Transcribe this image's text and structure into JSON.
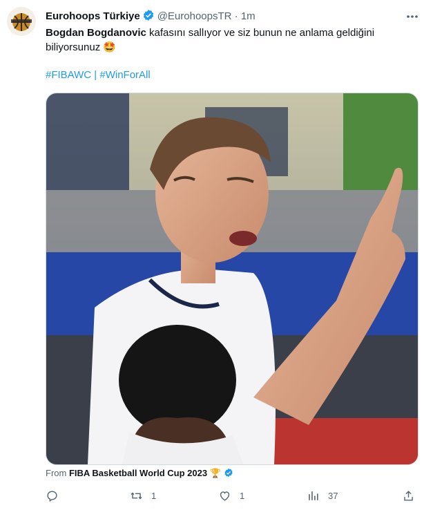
{
  "author": {
    "display_name": "Eurohoops Türkiye",
    "handle": "@EurohoopsTR",
    "separator": "·",
    "time": "1m",
    "avatar_icon": "basketball-logo-icon"
  },
  "tweet": {
    "bold_name": "Bogdan Bogdanovic",
    "text": " kafasını sallıyor ve siz bunun ne anlama geldiğini biliyorsunuz",
    "emoji": "🤩",
    "hashtag_1": "#FIBAWC",
    "hashtag_sep": " | ",
    "hashtag_2": "#WinForAll"
  },
  "media": {
    "type": "video-thumbnail",
    "icon": "video-frame-basketball-player"
  },
  "source": {
    "prefix": "From ",
    "name": "FIBA Basketball World Cup 2023",
    "trophy": "🏆"
  },
  "actions": {
    "reply_count": "",
    "retweet_count": "1",
    "like_count": "1",
    "views_count": "37"
  },
  "colors": {
    "accent": "#1d9bf0",
    "text": "#0f1419",
    "muted": "#536471"
  }
}
